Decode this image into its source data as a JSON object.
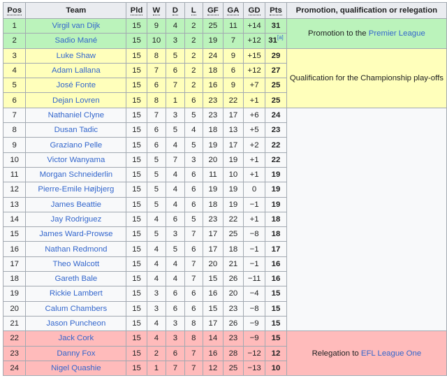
{
  "headers": {
    "pos": "Pos",
    "team": "Team",
    "pld": "Pld",
    "w": "W",
    "d": "D",
    "l": "L",
    "gf": "GF",
    "ga": "GA",
    "gd": "GD",
    "pts": "Pts",
    "note": "Promotion, qualification or relegation"
  },
  "zone_colors": {
    "promotion": "#bbf3bb",
    "playoffs": "#ffffbb",
    "relegation": "#ffbbbb",
    "neutral": "#f8f9fa",
    "link": "#3366cc"
  },
  "notes": {
    "promotion": {
      "prefix": "Promotion to the ",
      "link": "Premier League"
    },
    "playoffs": {
      "text": "Qualification for the Championship play-offs"
    },
    "relegation": {
      "prefix": "Relegation to ",
      "link": "EFL League One"
    }
  },
  "rows": [
    {
      "pos": "1",
      "team": "Virgil van Dijk",
      "pld": "15",
      "w": "9",
      "d": "4",
      "l": "2",
      "gf": "25",
      "ga": "11",
      "gd": "+14",
      "pts": "31"
    },
    {
      "pos": "2",
      "team": "Sadio Mané",
      "pld": "15",
      "w": "10",
      "d": "3",
      "l": "2",
      "gf": "19",
      "ga": "7",
      "gd": "+12",
      "pts": "31",
      "ref": "[a]"
    },
    {
      "pos": "3",
      "team": "Luke Shaw",
      "pld": "15",
      "w": "8",
      "d": "5",
      "l": "2",
      "gf": "24",
      "ga": "9",
      "gd": "+15",
      "pts": "29"
    },
    {
      "pos": "4",
      "team": "Adam Lallana",
      "pld": "15",
      "w": "7",
      "d": "6",
      "l": "2",
      "gf": "18",
      "ga": "6",
      "gd": "+12",
      "pts": "27"
    },
    {
      "pos": "5",
      "team": "José Fonte",
      "pld": "15",
      "w": "6",
      "d": "7",
      "l": "2",
      "gf": "16",
      "ga": "9",
      "gd": "+7",
      "pts": "25"
    },
    {
      "pos": "6",
      "team": "Dejan Lovren",
      "pld": "15",
      "w": "8",
      "d": "1",
      "l": "6",
      "gf": "23",
      "ga": "22",
      "gd": "+1",
      "pts": "25"
    },
    {
      "pos": "7",
      "team": "Nathaniel Clyne",
      "pld": "15",
      "w": "7",
      "d": "3",
      "l": "5",
      "gf": "23",
      "ga": "17",
      "gd": "+6",
      "pts": "24"
    },
    {
      "pos": "8",
      "team": "Dusan Tadic",
      "pld": "15",
      "w": "6",
      "d": "5",
      "l": "4",
      "gf": "18",
      "ga": "13",
      "gd": "+5",
      "pts": "23"
    },
    {
      "pos": "9",
      "team": "Graziano Pelle",
      "pld": "15",
      "w": "6",
      "d": "4",
      "l": "5",
      "gf": "19",
      "ga": "17",
      "gd": "+2",
      "pts": "22"
    },
    {
      "pos": "10",
      "team": "Victor Wanyama",
      "pld": "15",
      "w": "5",
      "d": "7",
      "l": "3",
      "gf": "20",
      "ga": "19",
      "gd": "+1",
      "pts": "22"
    },
    {
      "pos": "11",
      "team": "Morgan Schneiderlin",
      "pld": "15",
      "w": "5",
      "d": "4",
      "l": "6",
      "gf": "11",
      "ga": "10",
      "gd": "+1",
      "pts": "19"
    },
    {
      "pos": "12",
      "team": "Pierre-Emile Højbjerg",
      "pld": "15",
      "w": "5",
      "d": "4",
      "l": "6",
      "gf": "19",
      "ga": "19",
      "gd": "0",
      "pts": "19"
    },
    {
      "pos": "13",
      "team": "James Beattie",
      "pld": "15",
      "w": "5",
      "d": "4",
      "l": "6",
      "gf": "18",
      "ga": "19",
      "gd": "−1",
      "pts": "19"
    },
    {
      "pos": "14",
      "team": "Jay Rodriguez",
      "pld": "15",
      "w": "4",
      "d": "6",
      "l": "5",
      "gf": "23",
      "ga": "22",
      "gd": "+1",
      "pts": "18"
    },
    {
      "pos": "15",
      "team": "James Ward-Prowse",
      "pld": "15",
      "w": "5",
      "d": "3",
      "l": "7",
      "gf": "17",
      "ga": "25",
      "gd": "−8",
      "pts": "18"
    },
    {
      "pos": "16",
      "team": "Nathan Redmond",
      "pld": "15",
      "w": "4",
      "d": "5",
      "l": "6",
      "gf": "17",
      "ga": "18",
      "gd": "−1",
      "pts": "17"
    },
    {
      "pos": "17",
      "team": "Theo Walcott",
      "pld": "15",
      "w": "4",
      "d": "4",
      "l": "7",
      "gf": "20",
      "ga": "21",
      "gd": "−1",
      "pts": "16"
    },
    {
      "pos": "18",
      "team": "Gareth Bale",
      "pld": "15",
      "w": "4",
      "d": "4",
      "l": "7",
      "gf": "15",
      "ga": "26",
      "gd": "−11",
      "pts": "16"
    },
    {
      "pos": "19",
      "team": "Rickie Lambert",
      "pld": "15",
      "w": "3",
      "d": "6",
      "l": "6",
      "gf": "16",
      "ga": "20",
      "gd": "−4",
      "pts": "15"
    },
    {
      "pos": "20",
      "team": "Calum Chambers",
      "pld": "15",
      "w": "3",
      "d": "6",
      "l": "6",
      "gf": "15",
      "ga": "23",
      "gd": "−8",
      "pts": "15"
    },
    {
      "pos": "21",
      "team": "Jason Puncheon",
      "pld": "15",
      "w": "4",
      "d": "3",
      "l": "8",
      "gf": "17",
      "ga": "26",
      "gd": "−9",
      "pts": "15"
    },
    {
      "pos": "22",
      "team": "Jack Cork",
      "pld": "15",
      "w": "4",
      "d": "3",
      "l": "8",
      "gf": "14",
      "ga": "23",
      "gd": "−9",
      "pts": "15"
    },
    {
      "pos": "23",
      "team": "Danny Fox",
      "pld": "15",
      "w": "2",
      "d": "6",
      "l": "7",
      "gf": "16",
      "ga": "28",
      "gd": "−12",
      "pts": "12"
    },
    {
      "pos": "24",
      "team": "Nigel Quashie",
      "pld": "15",
      "w": "1",
      "d": "7",
      "l": "7",
      "gf": "12",
      "ga": "25",
      "gd": "−13",
      "pts": "10"
    }
  ]
}
